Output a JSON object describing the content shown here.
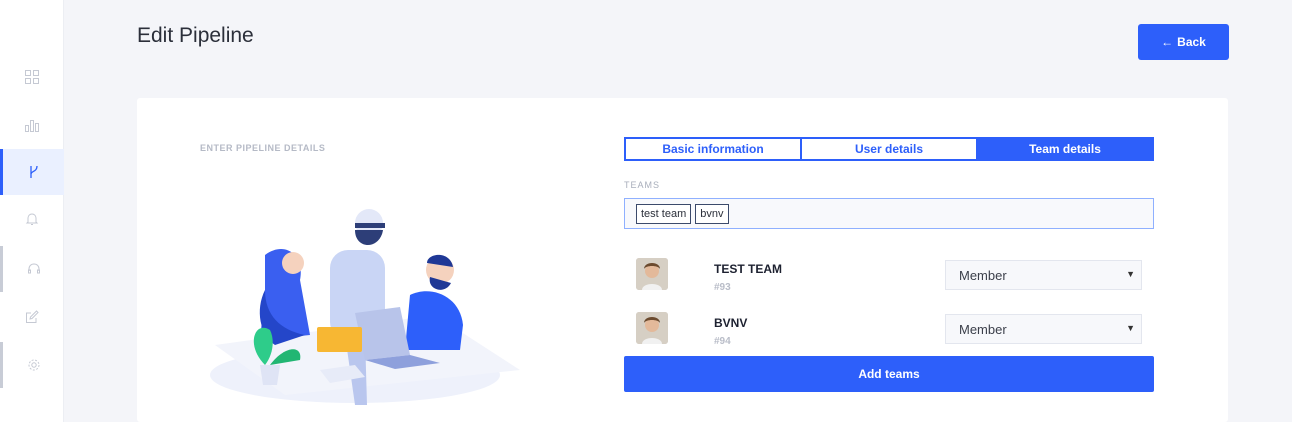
{
  "sidebar": {
    "items": [
      {
        "icon": "grid-icon"
      },
      {
        "icon": "chart-icon"
      },
      {
        "icon": "pipeline-branch-icon",
        "active": true
      },
      {
        "icon": "bell-icon"
      },
      {
        "icon": "headset-icon"
      },
      {
        "icon": "edit-icon"
      },
      {
        "icon": "settings-icon"
      }
    ]
  },
  "header": {
    "title": "Edit Pipeline",
    "back_label": "Back",
    "back_icon": "←"
  },
  "form": {
    "section_label": "ENTER PIPELINE DETAILS",
    "tabs": [
      {
        "label": "Basic information"
      },
      {
        "label": "User details"
      },
      {
        "label": "Team details",
        "active": true
      }
    ],
    "teams_label": "TEAMS",
    "selected_chips": [
      "test team",
      "bvnv"
    ],
    "teams": [
      {
        "name": "TEST TEAM",
        "id": "#93",
        "role": "Member"
      },
      {
        "name": "BVNV",
        "id": "#94",
        "role": "Member"
      }
    ],
    "add_label": "Add teams"
  },
  "colors": {
    "accent": "#2d5ffa",
    "background": "#f4f5f9"
  }
}
